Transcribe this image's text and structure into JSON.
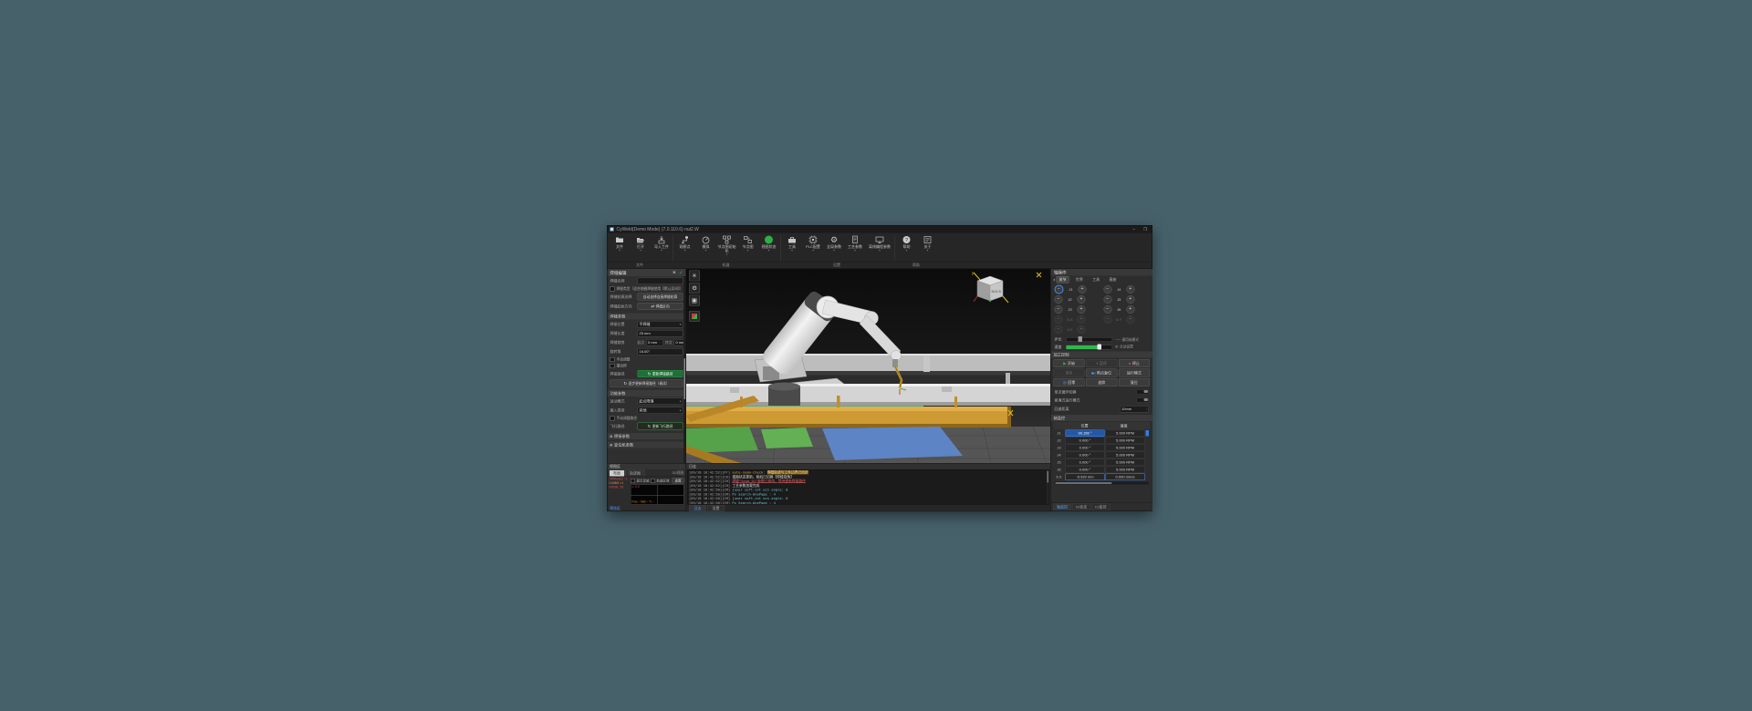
{
  "page": {
    "background": "#47616b"
  },
  "window": {
    "title": "CyWeld(Demo Mode) (7.0.110.6) nut2.W",
    "minimize_label": "–",
    "maximize_label": "❐"
  },
  "toolbar": {
    "groups": [
      {
        "label": "文件"
      },
      {
        "label": "机器"
      },
      {
        "label": "设置"
      },
      {
        "label": "帮助"
      }
    ],
    "items": [
      {
        "label": "文件"
      },
      {
        "label": "打开"
      },
      {
        "label": "导入工件"
      },
      {
        "label": "观察点"
      },
      {
        "label": "模拟"
      },
      {
        "label": "节点图初始化"
      },
      {
        "label": "节点图"
      },
      {
        "label": "视图状态"
      },
      {
        "label": "工具"
      },
      {
        "label": "PLC配置"
      },
      {
        "label": "全局参数"
      },
      {
        "label": "工艺参数"
      },
      {
        "label": "离线编程参数"
      },
      {
        "label": "帮助"
      },
      {
        "label": "关于"
      }
    ]
  },
  "seam_panel": {
    "title": "焊缝编辑",
    "name_label": "焊缝名称",
    "name_value": "",
    "loop_checkbox": "焊缝类型（适合绕圈焊缝使用【默认反向】）",
    "contour_label": "焊缝轮廓选择",
    "contour_button": "自动选择连接焊缝轮廓",
    "direction_label": "焊缝起始方向",
    "direction_button": "焊缝反向",
    "params_section": "焊缝参数",
    "position_label": "焊接位置",
    "position_value": "平焊缝",
    "length_label": "焊缝长度",
    "length_value": "25 mm",
    "trim_label": "焊缝裁剪",
    "trim_start_label": "起点",
    "trim_start_value": "0 mm",
    "trim_end_label": "终点",
    "trim_end_value": "0 mm",
    "angle_label": "旋转角",
    "angle_value": "16.00°",
    "manual_checkbox": "手动调整",
    "weave_checkbox": "摆动焊",
    "path_label": "焊接路径",
    "update_path_button": "更新焊接路径",
    "step_update_button": "逐步更新焊接路径（调试）",
    "motion_section": "功能参数",
    "motion_mode_label": "运动模式",
    "motion_mode_value": "起点降落",
    "input_type_label": "输入类型",
    "input_type_value": "其他",
    "manual_fly_checkbox": "手动调整路径",
    "fly_label": "飞行路径",
    "update_fly_button": "更新飞行路径",
    "weld_params_section": "焊接参数",
    "positioner_section": "变位机参数"
  },
  "preview_panel": {
    "title": "视图区",
    "dots": "⸬",
    "tab_layout": "布局",
    "tab_track": "轨迹图",
    "tab_3d": "3D视图",
    "status_lines": [
      {
        "text": "VPMode2 ↑1"
      },
      {
        "text": "0.0MM ×1"
      },
      {
        "text": "0700E: 51"
      }
    ],
    "show_checkbox": "显示足迹",
    "area_checkbox": "轨迹区域",
    "reset_button": "重置",
    "thumb_top": "L: 0.0",
    "thumb_bottom": "Pos:-- Mid:-- T:--",
    "footer_link": "预览区"
  },
  "viewport": {
    "view_cube_label": "BACK",
    "axis_y_label": "y"
  },
  "log_panel": {
    "title": "日志",
    "tab_log": "日志",
    "tab_settings": "设置",
    "lines": [
      {
        "time": "[09/18 16:42:52][Pr]",
        "msg": "auto-seam-check: ",
        "hl": "焊缝轨迹与工件边界已同步"
      },
      {
        "time": "[09/18 16:42:52][CH]",
        "msg": "视图状态更新，相机已切换【焊缝视角】",
        "hl": ""
      },
      {
        "time": "[09/18 16:42:52][CH]",
        "msg": "焊缝“Seam_01”参数已修改，等待更新焊接路径",
        "hl": ""
      },
      {
        "time": "[09/18 16:42:52][CH]",
        "msg": "工艺参数加载完成",
        "hl": ""
      },
      {
        "time": "[09/18 16:42:50][CM]",
        "msg": "[user soft-int ecs angle: 0",
        "hl": ""
      },
      {
        "time": "[09/18 16:42:50][CM]",
        "msg": "Ps Search-OnePage : 4",
        "hl": ""
      },
      {
        "time": "[09/18 16:42:50][CM]",
        "msg": "[user soft-int ecs angle: 0",
        "hl": ""
      },
      {
        "time": "[09/18 16:42:50][CM]",
        "msg": "Ps Search-OnePage : 4",
        "hl": ""
      }
    ]
  },
  "axis_panel": {
    "title": "轴操作",
    "mode_arrow": "◂",
    "modes": [
      {
        "label": "关节"
      },
      {
        "label": "世界"
      },
      {
        "label": "工具"
      },
      {
        "label": "基座"
      }
    ],
    "jog_minus": "−",
    "jog_plus": "+",
    "jog": [
      {
        "label": "J1"
      },
      {
        "label": "J4"
      },
      {
        "label": "J2"
      },
      {
        "label": "J5"
      },
      {
        "label": "J3"
      },
      {
        "label": "J6"
      },
      {
        "label": "6.X"
      },
      {
        "label": "6.Y"
      },
      {
        "label": "6.Z"
      }
    ],
    "step_label": "步长",
    "step_hint": "⸺ 通用轴模式",
    "speed_label": "速度",
    "jog_settings": "点动设置",
    "control_section": "加工控制",
    "buttons": {
      "start": "开始",
      "pause": "暂停",
      "stop": "停止",
      "single_step": "单步",
      "breakpoint": "断点复位",
      "run_mode": "运行模式",
      "home": "回零",
      "trace": "追踪",
      "reset": "复位"
    },
    "toggle_single": "单次循环切换",
    "toggle_compact": "紧凑式运行模式",
    "retreat_label": "回退距离",
    "retreat_value": "10mm",
    "monitor_section": "轴监控",
    "table": {
      "col_pos": "位置",
      "col_speed": "速度",
      "rows": [
        {
          "axis": "J1",
          "pos": "90.156 °",
          "speed": "5.000 RPM"
        },
        {
          "axis": "J2",
          "pos": "0.000 °",
          "speed": "5.000 RPM"
        },
        {
          "axis": "J3",
          "pos": "0.000 °",
          "speed": "5.000 RPM"
        },
        {
          "axis": "J4",
          "pos": "0.000 °",
          "speed": "5.000 RPM"
        },
        {
          "axis": "J5",
          "pos": "0.000 °",
          "speed": "5.000 RPM"
        },
        {
          "axis": "J6",
          "pos": "0.000 °",
          "speed": "5.000 RPM"
        },
        {
          "axis": "6.X",
          "pos": "-5.929 mm",
          "speed": "0.000 mm/s"
        }
      ]
    },
    "tabs": [
      {
        "label": "轴监控"
      },
      {
        "label": "IO状态"
      },
      {
        "label": "IO监控"
      }
    ]
  },
  "colors": {
    "accent_green": "#2eb84d",
    "accent_blue": "#2f7fe0",
    "accent_red": "#d23b3b",
    "warn_orange": "#e0a040",
    "log_cyan": "#6fc3d0",
    "beam_orange": "#cd9a33",
    "patch_green": "#55a24b",
    "patch_blue": "#5d84c4"
  }
}
